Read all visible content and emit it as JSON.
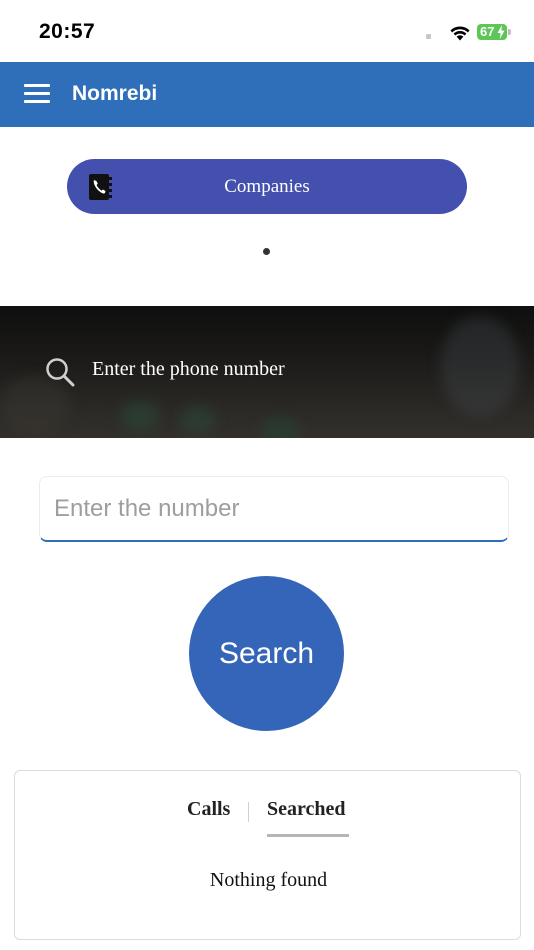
{
  "status_bar": {
    "time": "20:57",
    "battery": "67"
  },
  "app_bar": {
    "title": "Nomrebi"
  },
  "companies": {
    "label": "Companies"
  },
  "banner": {
    "label": "Enter the phone number"
  },
  "number_input": {
    "placeholder": "Enter the number",
    "value": ""
  },
  "search_button": {
    "label": "Search"
  },
  "tabs": {
    "items": [
      {
        "label": "Calls",
        "active": false
      },
      {
        "label": "Searched",
        "active": true
      }
    ],
    "empty_message": "Nothing found"
  },
  "colors": {
    "app_bar": "#2f6eb8",
    "companies_button": "#4450ae",
    "search_button": "#3565b8",
    "battery": "#5ec657"
  },
  "icons": [
    "wifi-icon",
    "battery-icon",
    "menu-icon",
    "phonebook-icon",
    "search-icon"
  ]
}
